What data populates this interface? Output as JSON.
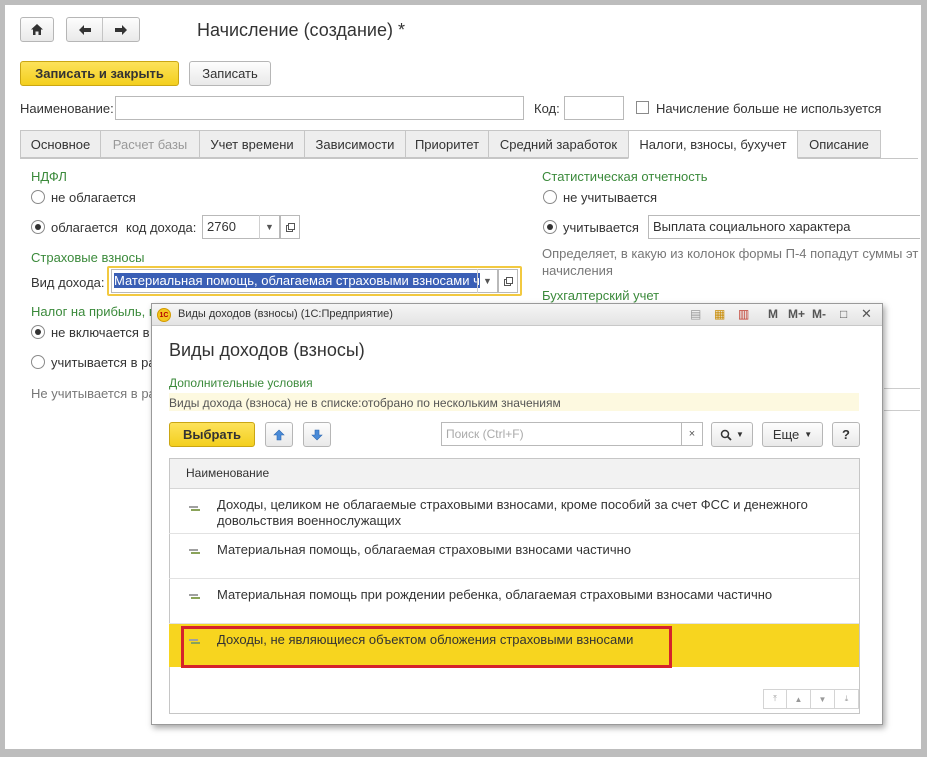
{
  "header": {
    "title": "Начисление (создание) *",
    "home_icon": "home-icon",
    "back_icon": "arrow-left-icon",
    "forward_icon": "arrow-right-icon"
  },
  "toolbar": {
    "save_close_label": "Записать и закрыть",
    "save_label": "Записать"
  },
  "form": {
    "name_label": "Наименование:",
    "name_value": "",
    "code_label": "Код:",
    "code_value": "",
    "obsolete_label": "Начисление больше не используется"
  },
  "tabs": [
    {
      "label": "Основное"
    },
    {
      "label": "Расчет базы"
    },
    {
      "label": "Учет времени"
    },
    {
      "label": "Зависимости"
    },
    {
      "label": "Приоритет"
    },
    {
      "label": "Средний заработок"
    },
    {
      "label": "Налоги, взносы, бухучет"
    },
    {
      "label": "Описание"
    }
  ],
  "ndfl": {
    "header": "НДФЛ",
    "option_not_taxed": "не облагается",
    "option_taxed": "облагается",
    "income_code_label": "код дохода:",
    "income_code_value": "2760"
  },
  "insurance": {
    "header": "Страховые взносы",
    "income_type_label": "Вид дохода:",
    "income_type_value": "Материальная помощь, облагаемая страховыми взносами ч"
  },
  "profit_tax": {
    "header": "Налог на прибыль, в",
    "option_not_included": "не включается в",
    "option_included": "учитывается в ра",
    "note": "Не учитывается в ра"
  },
  "stat": {
    "header": "Статистическая отчетность",
    "option_not_counted": "не учитывается",
    "option_counted": "учитывается",
    "counted_value": "Выплата социального характера",
    "description_line1": "Определяет, в какую из колонок формы П-4 попадут суммы эт",
    "description_line2": "начисления"
  },
  "accounting": {
    "header": "Бухгалтерский учет"
  },
  "modal": {
    "window_title": "Виды доходов (взносы)  (1С:Предприятие)",
    "title": "Виды доходов (взносы)",
    "conditions_header": "Дополнительные условия",
    "conditions_text": "Виды дохода (взноса) не в списке:отобрано по нескольким значениям",
    "select_label": "Выбрать",
    "search_placeholder": "Поиск (Ctrl+F)",
    "more_label": "Еще",
    "help_label": "?",
    "column_header": "Наименование",
    "rows": [
      {
        "text": "Доходы, целиком не облагаемые страховыми взносами, кроме пособий за счет ФСС и денежного довольствия военнослужащих"
      },
      {
        "text": "Материальная помощь, облагаемая страховыми взносами частично"
      },
      {
        "text": "Материальная помощь при рождении ребенка, облагаемая страховыми взносами частично"
      },
      {
        "text": "Доходы, не являющиеся объектом обложения страховыми взносами"
      }
    ],
    "title_buttons": {
      "m": "M",
      "m_plus": "M+",
      "m_minus": "M-"
    }
  },
  "colors": {
    "accent_yellow": "#f6d32d",
    "selection_highlight": "#f7d51f",
    "highlight_border": "#d5232b",
    "section_green": "#3b8a3b"
  }
}
